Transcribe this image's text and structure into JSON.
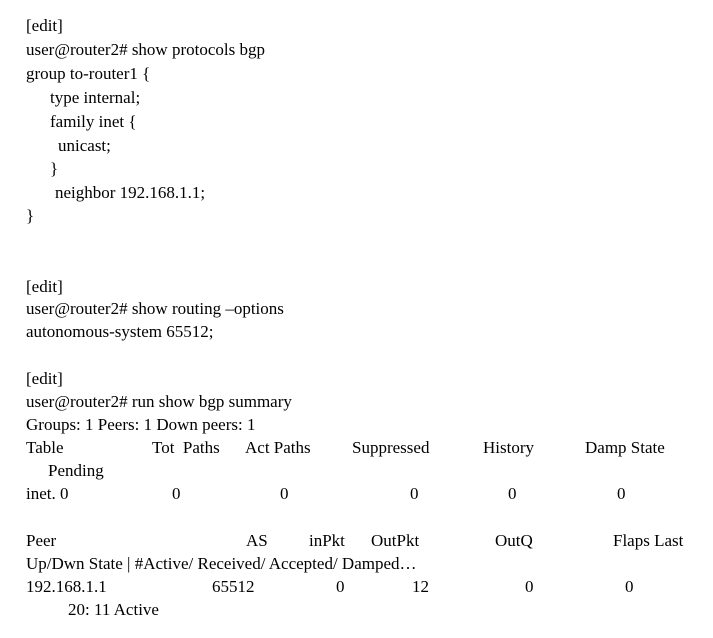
{
  "terminal": {
    "background_color": "#ffffff",
    "text_color": "#000000",
    "blocks": [
      {
        "name": "show-protocols-bgp-block",
        "prompt_context": "[edit]",
        "prompt": "user@router2# show protocols bgp",
        "config_lines": [
          "group to-router1 {",
          "type internal;",
          "family inet {",
          "unicast;",
          "}",
          "neighbor 192.168.1.1;",
          "}"
        ]
      },
      {
        "name": "show-routing-options-block",
        "prompt_context": "[edit]",
        "prompt": "user@router2# show routing –options",
        "config_lines": [
          "autonomous-system 65512;"
        ]
      },
      {
        "name": "run-show-bgp-summary-block",
        "prompt_context": "[edit]",
        "prompt": "user@router2# run show bgp summary",
        "summary_line": "Groups: 1 Peers: 1 Down peers: 1"
      }
    ],
    "table_routing": {
      "headers": [
        "Table",
        "Tot  Paths",
        "Act Paths",
        "Suppressed",
        "History",
        "Damp State"
      ],
      "header_continuation": "Pending",
      "rows": [
        {
          "table": "inet. 0",
          "tot_paths": "0",
          "act_paths": "0",
          "suppressed": "0",
          "history": "0",
          "damp_state": "0"
        }
      ]
    },
    "table_peer": {
      "headers": [
        "Peer",
        "AS",
        "inPkt",
        "OutPkt",
        "OutQ",
        "Flaps Last"
      ],
      "header_continuation": "Up/Dwn State | #Active/ Received/ Accepted/ Damped…",
      "rows": [
        {
          "peer": "192.168.1.1",
          "as": "65512",
          "in_pkt": "0",
          "out_pkt": "12",
          "out_q": "0",
          "flaps": "0",
          "state_line": "20: 11 Active"
        }
      ]
    }
  }
}
